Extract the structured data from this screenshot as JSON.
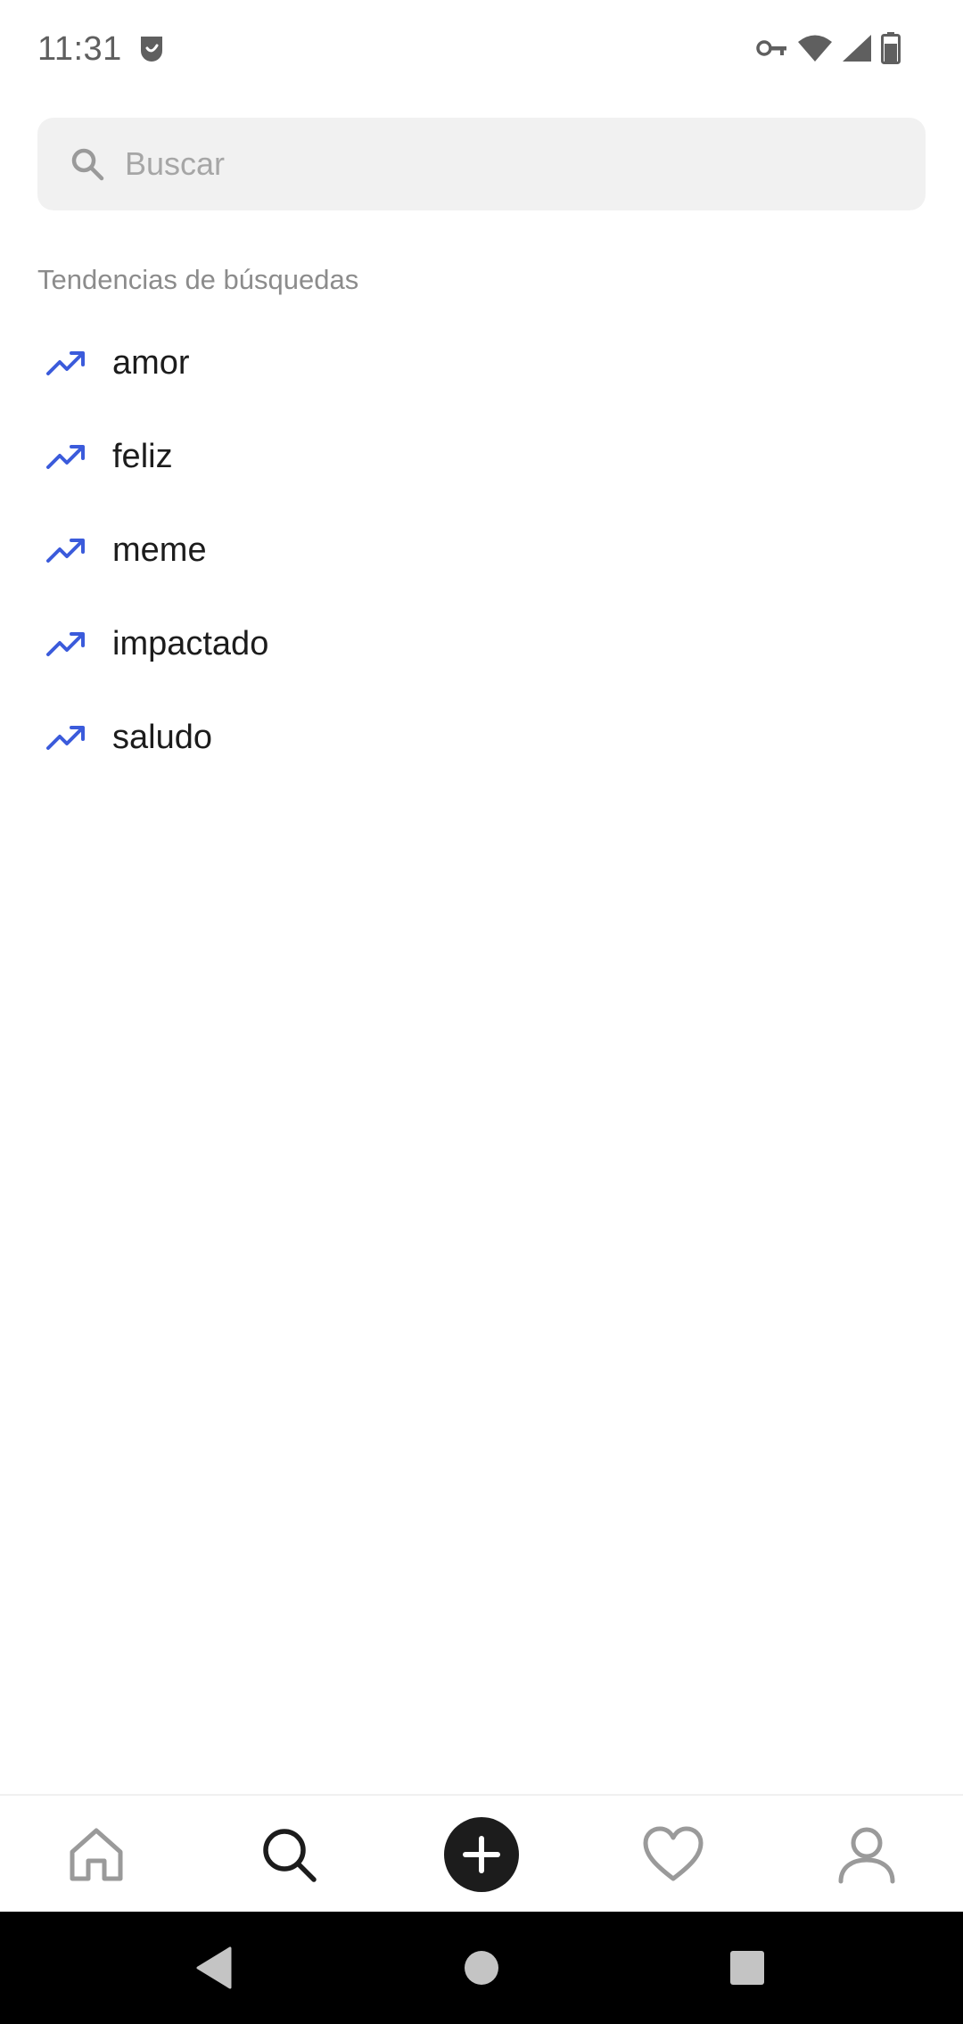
{
  "status_bar": {
    "time": "11:31",
    "icons": [
      "vpn-key-icon",
      "wifi-icon",
      "signal-icon",
      "battery-icon"
    ]
  },
  "search": {
    "placeholder": "Buscar",
    "value": ""
  },
  "trending": {
    "title": "Tendencias de búsquedas",
    "items": [
      {
        "label": "amor",
        "icon": "trending-up-icon"
      },
      {
        "label": "feliz",
        "icon": "trending-up-icon"
      },
      {
        "label": "meme",
        "icon": "trending-up-icon"
      },
      {
        "label": "impactado",
        "icon": "trending-up-icon"
      },
      {
        "label": "saludo",
        "icon": "trending-up-icon"
      }
    ]
  },
  "bottom_nav": {
    "items": [
      "home-icon",
      "search-icon",
      "add-icon",
      "heart-icon",
      "profile-icon"
    ],
    "active": "search-icon"
  },
  "colors": {
    "accent": "#3b5bdb",
    "search_bg": "#f1f1f1",
    "create_button": "#1c1c1c"
  }
}
